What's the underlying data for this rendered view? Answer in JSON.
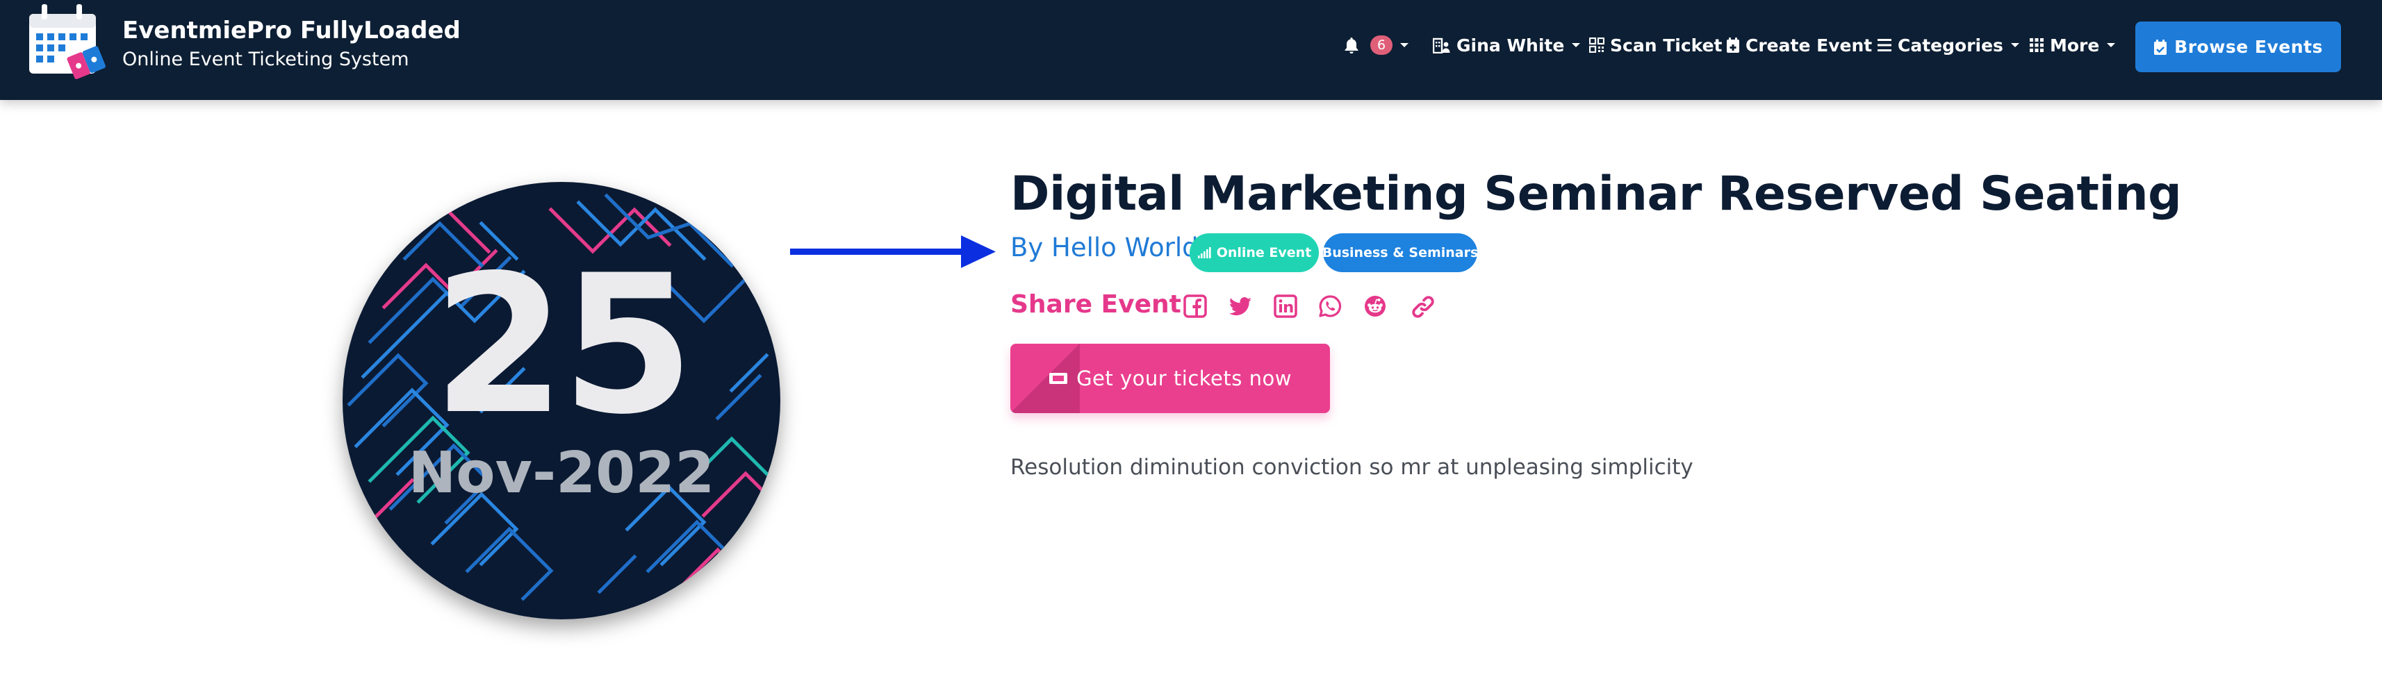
{
  "header": {
    "brand_title": "EventmiePro FullyLoaded",
    "brand_subtitle": "Online Event Ticketing System",
    "notification_count": "6",
    "user_name": "Gina White",
    "scan_ticket": "Scan Ticket",
    "create_event": "Create Event",
    "categories": "Categories",
    "more": "More",
    "browse_events": "Browse Events"
  },
  "event": {
    "date_day": "25",
    "date_month_year": "Nov-2022",
    "title": "Digital Marketing Seminar Reserved Seating",
    "organiser": "By Hello World",
    "badge_online": "Online Event",
    "badge_category": "Business & Seminars",
    "share_label": "Share Event",
    "share_icons": [
      "facebook-icon",
      "twitter-icon",
      "linkedin-icon",
      "whatsapp-icon",
      "reddit-icon",
      "link-icon"
    ],
    "ticket_button": "Get your tickets now",
    "excerpt": "Resolution diminution conviction so mr at unpleasing simplicity"
  },
  "colors": {
    "header_bg": "#0d1f34",
    "accent_blue": "#1e7cd8",
    "accent_pink": "#e5388b",
    "badge_teal": "#20d4b3",
    "title_dark": "#0c1c33",
    "arrow_blue": "#0b2fe0"
  }
}
